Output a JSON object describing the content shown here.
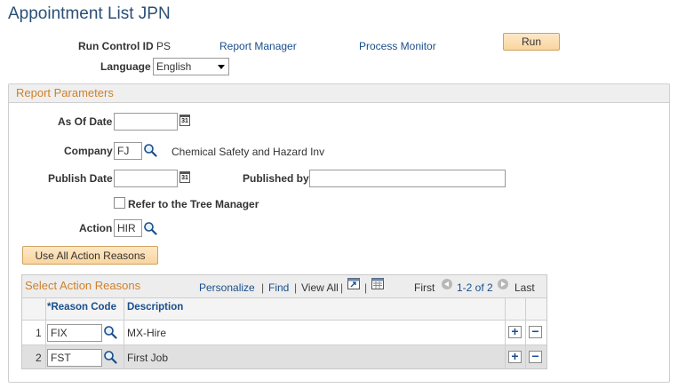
{
  "page": {
    "title": "Appointment List JPN"
  },
  "header": {
    "run_control_label": "Run Control ID",
    "run_control_value": "PS",
    "report_manager_link": "Report Manager",
    "process_monitor_link": "Process Monitor",
    "run_button": "Run",
    "language_label": "Language",
    "language_value": "English"
  },
  "params": {
    "section_title": "Report Parameters",
    "as_of_date_label": "As Of Date",
    "as_of_date_value": "",
    "company_label": "Company",
    "company_value": "FJ",
    "company_description": "Chemical Safety and Hazard Inv",
    "publish_date_label": "Publish Date",
    "publish_date_value": "",
    "published_by_label": "Published by",
    "published_by_value": "",
    "tree_manager_label": "Refer to the Tree Manager",
    "tree_manager_checked": false,
    "action_label": "Action",
    "action_value": "HIR",
    "use_all_button": "Use All Action Reasons",
    "calendar_icon_text": "31"
  },
  "grid": {
    "title": "Select Action Reasons",
    "personalize": "Personalize",
    "find": "Find",
    "view_all": "View All",
    "first": "First",
    "range": "1-2 of 2",
    "last": "Last",
    "col_reason_code": "*Reason Code",
    "col_description": "Description",
    "add_symbol": "+",
    "remove_symbol": "−",
    "rows": [
      {
        "num": "1",
        "code": "FIX",
        "description": "MX-Hire"
      },
      {
        "num": "2",
        "code": "FST",
        "description": "First Job"
      }
    ]
  },
  "colors": {
    "title": "#2b4f76",
    "link": "#1a4e8c",
    "section_title": "#d0802a",
    "button_bg": "#f9d59e"
  },
  "icons": [
    "calendar-icon",
    "lookup-icon",
    "zoom-icon",
    "download-icon",
    "prev-icon",
    "next-icon",
    "add-row-icon",
    "delete-row-icon"
  ]
}
